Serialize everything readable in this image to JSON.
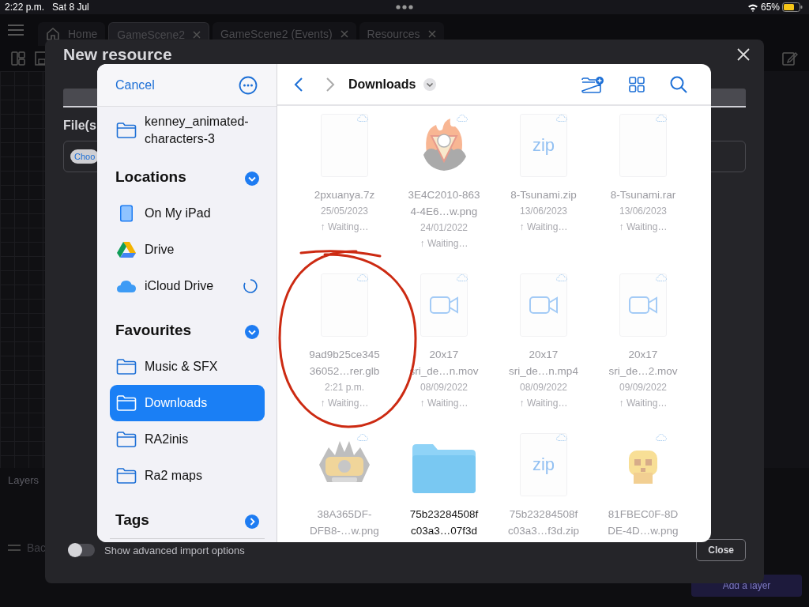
{
  "status_bar": {
    "time": "2:22 p.m.",
    "date": "Sat 8 Jul",
    "battery": "65%"
  },
  "app_tabs": [
    {
      "kind": "home",
      "label": "Home",
      "selected": false
    },
    {
      "kind": "tab",
      "label": "GameScene2",
      "selected": true
    },
    {
      "kind": "tab",
      "label": "GameScene2 (Events)",
      "selected": false
    },
    {
      "kind": "tab",
      "label": "Resources",
      "selected": false
    }
  ],
  "layers_panel": {
    "title": "Layers",
    "layer_label": "Bac",
    "add_button": "Add a layer"
  },
  "dialog": {
    "title": "New resource",
    "files_label": "File(s",
    "choose_button": "Choo",
    "advanced_toggle": {
      "label": "Show advanced import options",
      "on": false
    },
    "close_button": "Close"
  },
  "picker": {
    "cancel": "Cancel",
    "folder_title": "Downloads",
    "sidebar": [
      {
        "kind": "folder",
        "label": "kenney_animated-characters-3",
        "selected": false
      },
      {
        "kind": "section",
        "label": "Locations",
        "expanded": true
      },
      {
        "kind": "tablet",
        "label": "On My iPad",
        "selected": false
      },
      {
        "kind": "drive",
        "label": "Drive",
        "selected": false
      },
      {
        "kind": "cloud",
        "label": "iCloud Drive",
        "selected": false,
        "syncing": true
      },
      {
        "kind": "section",
        "label": "Favourites",
        "expanded": true
      },
      {
        "kind": "folder",
        "label": "Music & SFX",
        "selected": false
      },
      {
        "kind": "folder",
        "label": "Downloads",
        "selected": true
      },
      {
        "kind": "folder",
        "label": "RA2inis",
        "selected": false
      },
      {
        "kind": "folder",
        "label": "Ra2 maps",
        "selected": false
      },
      {
        "kind": "section",
        "label": "Tags",
        "expanded": false
      }
    ],
    "files": [
      {
        "kind": "blank",
        "name_lines": [
          "2pxuanya.7z"
        ],
        "date": "25/05/2023",
        "status": "↑ Waiting…",
        "in_cloud": true,
        "disabled": true
      },
      {
        "kind": "picture",
        "name_lines": [
          "3E4C2010-863",
          "4-4E6…w.png"
        ],
        "date": "24/01/2022",
        "status": "↑ Waiting…",
        "in_cloud": true,
        "disabled": true
      },
      {
        "kind": "zip",
        "thumb_text": "zip",
        "name_lines": [
          "8-Tsunami.zip"
        ],
        "date": "13/06/2023",
        "status": "↑ Waiting…",
        "in_cloud": true,
        "disabled": true
      },
      {
        "kind": "blank",
        "name_lines": [
          "8-Tsunami.rar"
        ],
        "date": "13/06/2023",
        "status": "↑ Waiting…",
        "in_cloud": true,
        "disabled": true
      },
      {
        "kind": "blank",
        "name_lines": [
          "9ad9b25ce345",
          "36052…rer.glb"
        ],
        "date": "2:21 p.m.",
        "status": "↑ Waiting…",
        "in_cloud": true,
        "disabled": true
      },
      {
        "kind": "video",
        "name_lines": [
          "20x17",
          "sri_de…n.mov"
        ],
        "date": "08/09/2022",
        "status": "↑ Waiting…",
        "in_cloud": true,
        "disabled": true
      },
      {
        "kind": "video",
        "name_lines": [
          "20x17",
          "sri_de…n.mp4"
        ],
        "date": "08/09/2022",
        "status": "↑ Waiting…",
        "in_cloud": true,
        "disabled": true
      },
      {
        "kind": "video",
        "name_lines": [
          "20x17",
          "sri_de…2.mov"
        ],
        "date": "09/09/2022",
        "status": "↑ Waiting…",
        "in_cloud": true,
        "disabled": true
      },
      {
        "kind": "picture",
        "name_lines": [
          "38A365DF-",
          "DFB8-…w.png"
        ],
        "in_cloud": true,
        "disabled": true
      },
      {
        "kind": "folder",
        "name_lines": [
          "75b23284508f",
          "c03a3…07f3d"
        ],
        "disabled": false
      },
      {
        "kind": "zip",
        "thumb_text": "zip",
        "name_lines": [
          "75b23284508f",
          "c03a3…f3d.zip"
        ],
        "in_cloud": true,
        "disabled": true
      },
      {
        "kind": "picture",
        "name_lines": [
          "81FBEC0F-8D",
          "DE-4D…w.png"
        ],
        "in_cloud": true,
        "disabled": true
      }
    ]
  }
}
